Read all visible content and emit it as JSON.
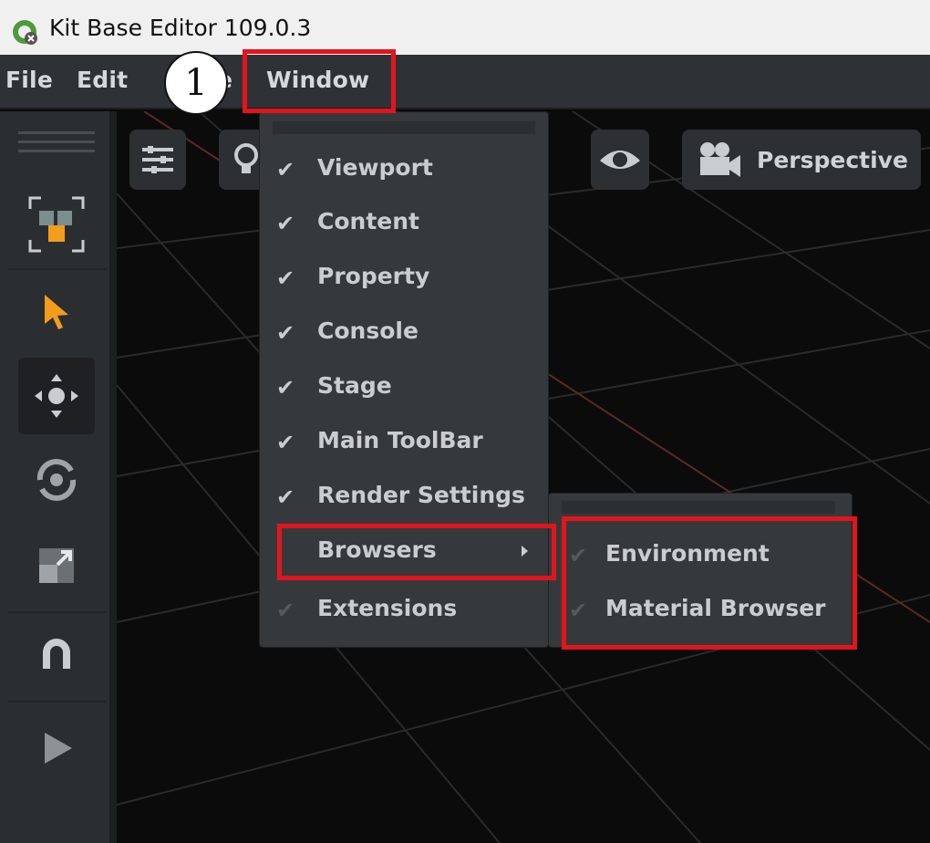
{
  "window": {
    "title": "Kit Base Editor 109.0.3",
    "icon": "omniverse-logo-icon"
  },
  "menubar": {
    "items": [
      "File",
      "Edit",
      "e",
      "Window"
    ]
  },
  "annotation": {
    "step": "1"
  },
  "viewport": {
    "camera_label": "Perspective",
    "buttons": [
      "settings-sliders-icon",
      "lightbulb-icon",
      "eye-icon",
      "camera-icon"
    ]
  },
  "left_toolbar": {
    "tools": [
      "selection-mode-icon",
      "select-arrow-icon",
      "move-icon",
      "rotate-icon",
      "scale-icon",
      "snap-magnet-icon",
      "play-icon"
    ]
  },
  "window_menu": {
    "items": [
      {
        "label": "Viewport",
        "checked": true
      },
      {
        "label": "Content",
        "checked": true
      },
      {
        "label": "Property",
        "checked": true
      },
      {
        "label": "Console",
        "checked": true
      },
      {
        "label": "Stage",
        "checked": true
      },
      {
        "label": "Main ToolBar",
        "checked": true
      },
      {
        "label": "Render Settings",
        "checked": true
      },
      {
        "label": "Browsers",
        "checked": false,
        "submenu": true
      },
      {
        "label": "Extensions",
        "checked": false
      }
    ]
  },
  "browsers_submenu": {
    "items": [
      {
        "label": "Environment",
        "checked": false
      },
      {
        "label": "Material Browser",
        "checked": false
      }
    ]
  },
  "colors": {
    "highlight_box": "#e3141c",
    "accent_orange": "#f39c1e",
    "menu_bg": "#36393c"
  }
}
